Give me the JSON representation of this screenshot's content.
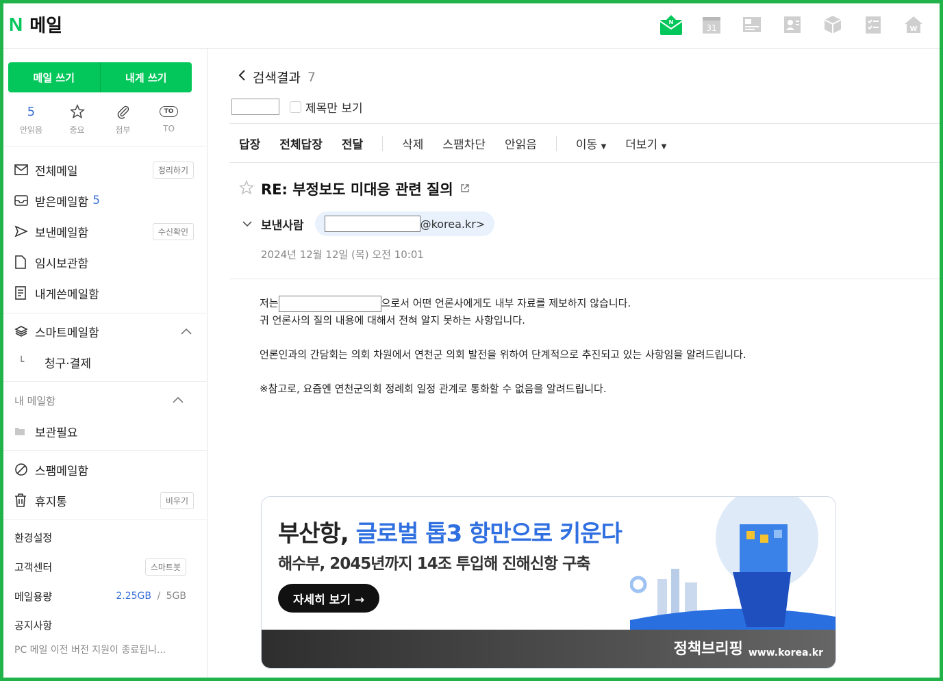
{
  "header": {
    "logo": "N",
    "title": "메일",
    "apps": [
      "mail-icon",
      "calendar-icon",
      "news-icon",
      "contacts-icon",
      "box-icon",
      "todo-icon",
      "home-icon"
    ],
    "calendar_day": "31"
  },
  "sidebar": {
    "write_mail": "메일 쓰기",
    "write_to_me": "내게 쓰기",
    "quick": {
      "unread_count": "5",
      "unread": "안읽음",
      "important": "중요",
      "attach": "첨부",
      "to_label": "TO",
      "to_icon_text": "TO"
    },
    "folders": {
      "all": "전체메일",
      "all_action": "정리하기",
      "inbox": "받은메일함",
      "inbox_count": "5",
      "sent": "보낸메일함",
      "sent_action": "수신확인",
      "drafts": "임시보관함",
      "to_me": "내게쓴메일함",
      "smart": "스마트메일함",
      "billing": "청구·결제",
      "my_folders": "내 메일함",
      "keep": "보관필요",
      "spam": "스팸메일함",
      "trash": "휴지통",
      "trash_action": "비우기"
    },
    "settings": "환경설정",
    "support": "고객센터",
    "support_action": "스마트봇",
    "storage_label": "메일용량",
    "storage_used": "2.25GB",
    "storage_sep": "/",
    "storage_total": "5GB",
    "notice_label": "공지사항",
    "notice_text": "PC 메일 이전 버전 지원이 종료됩니..."
  },
  "main": {
    "back_label": "검색결과",
    "result_count": "7",
    "subject_only": "제목만 보기",
    "toolbar": {
      "reply": "답장",
      "reply_all": "전체답장",
      "forward": "전달",
      "delete": "삭제",
      "block_spam": "스팸차단",
      "mark_unread": "안읽음",
      "move": "이동",
      "more": "더보기"
    },
    "subject": "RE: 부정보도 미대응 관련 질의",
    "sender_label": "보낸사람",
    "sender_domain": "@korea.kr>",
    "date": "2024년 12월 12일 (목) 오전 10:01",
    "body": {
      "line1_pre": "저는",
      "line1_post": "으로서 어떤 언론사에게도 내부 자료를 제보하지 않습니다.",
      "line2": "귀 언론사의 질의 내용에 대해서 전혀 알지 못하는 사항입니다.",
      "line3": "언론인과의 간담회는 의회 차원에서 연천군 의회 발전을 위하여 단계적으로 추진되고 있는 사항임을 알려드립니다.",
      "line4": "※참고로, 요즘엔 연천군의회 정례회 일정 관계로 통화할 수 없음을 알려드립니다."
    }
  },
  "banner": {
    "headline_a": "부산항,",
    "headline_b": "글로벌 톱3 항만으로 키운다",
    "subline": "해수부, 2045년까지 14조 투입해 진해신항 구축",
    "cta": "자세히 보기 →",
    "brand": "정책브리핑",
    "site": "www.korea.kr"
  },
  "colors": {
    "accent": "#03c75a",
    "frame": "#1fb34a",
    "link": "#3a6fd8",
    "highlight": "#2f6fe0"
  }
}
